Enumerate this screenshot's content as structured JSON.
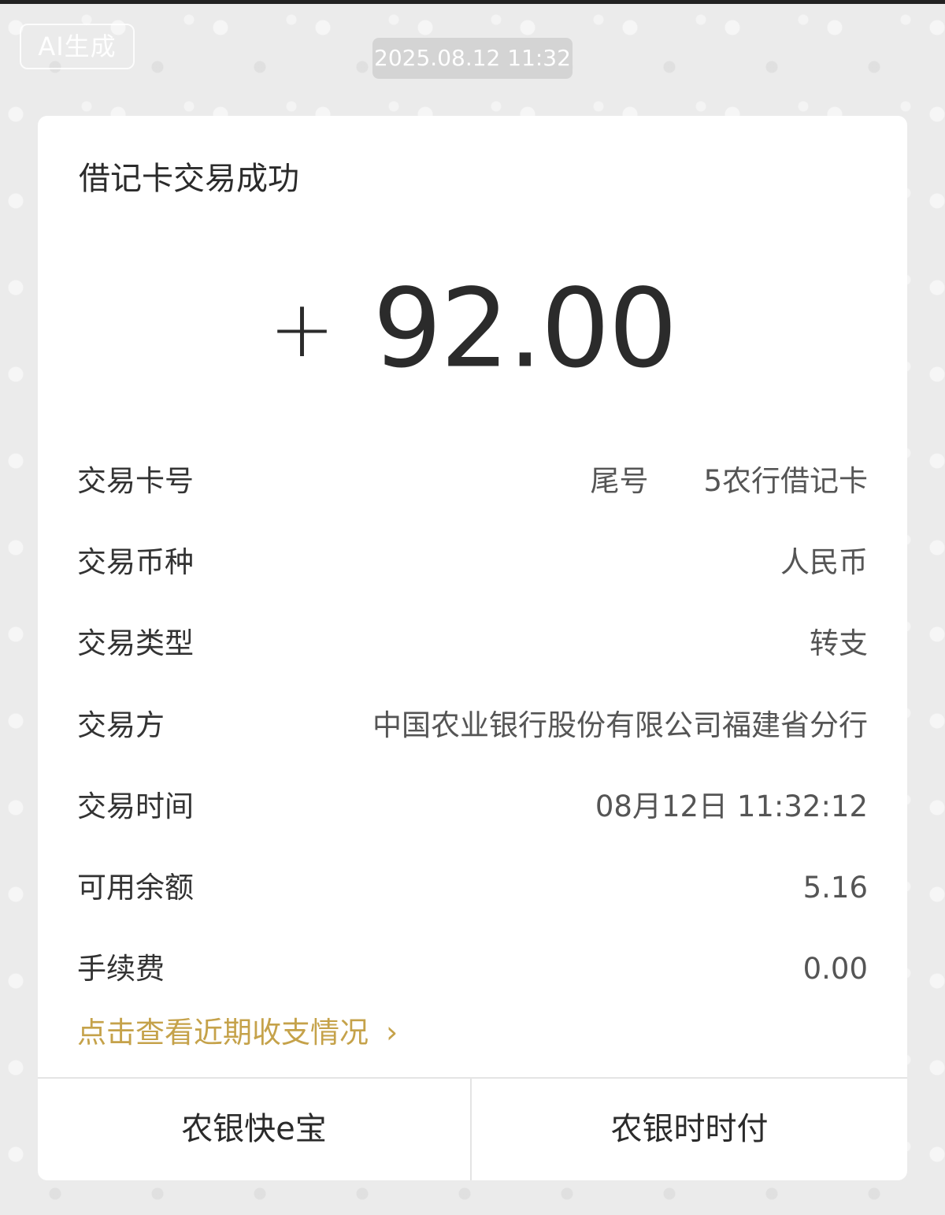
{
  "overlay": {
    "ai_badge": "AI生成",
    "timestamp": "2025.08.12 11:32"
  },
  "card": {
    "title": "借记卡交易成功",
    "amount_sign": "+",
    "amount_value": "92.00",
    "rows": [
      {
        "label": "交易卡号",
        "value_prefix": "尾号",
        "value_suffix": "5农行借记卡"
      },
      {
        "label": "交易币种",
        "value": "人民币"
      },
      {
        "label": "交易类型",
        "value": "转支"
      },
      {
        "label": "交易方",
        "value": "中国农业银行股份有限公司福建省分行"
      },
      {
        "label": "交易时间",
        "value": "08月12日 11:32:12"
      },
      {
        "label": "可用余额",
        "value": "5.16"
      },
      {
        "label": "手续费",
        "value": "0.00"
      }
    ],
    "link_label": "点击查看近期收支情况",
    "link_chevron": "›"
  },
  "buttons": {
    "left": "农银快e宝",
    "right": "农银时时付"
  },
  "colors": {
    "accent_gold": "#c5a24a",
    "card_bg": "#ffffff",
    "page_bg": "#ebebeb"
  }
}
